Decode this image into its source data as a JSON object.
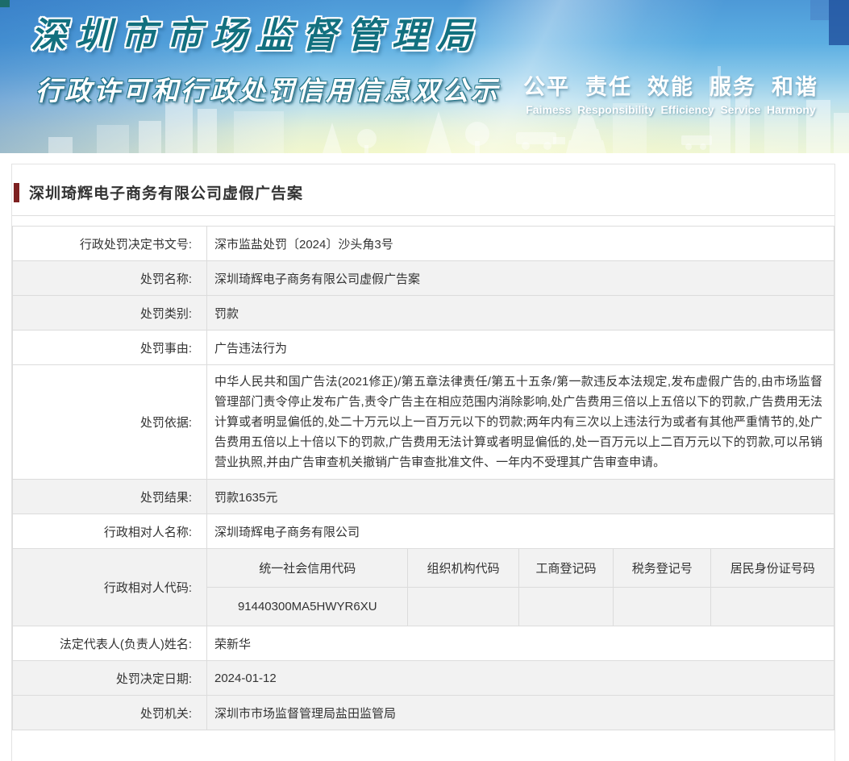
{
  "banner": {
    "title": "深圳市市场监督管理局",
    "subtitle": "行政许可和行政处罚信用信息双公示",
    "slogan_cn": "公平  责任  效能  服务  和谐",
    "slogan_en": "Faimess  Responsibility  Efficiency  Service  Harmony"
  },
  "colors": {
    "accent_bar": "#7d2020",
    "row_stripe": "#f2f2f2",
    "banner_title_teal": "#12707f"
  },
  "page": {
    "title": "深圳琦辉电子商务有限公司虚假广告案"
  },
  "table": {
    "rows": [
      {
        "label": "行政处罚决定书文号:",
        "value": "深市监盐处罚〔2024〕沙头角3号"
      },
      {
        "label": "处罚名称:",
        "value": "深圳琦辉电子商务有限公司虚假广告案"
      },
      {
        "label": "处罚类别:",
        "value": "罚款"
      },
      {
        "label": "处罚事由:",
        "value": "广告违法行为"
      },
      {
        "label": "处罚依据:",
        "value": "中华人民共和国广告法(2021修正)/第五章法律责任/第五十五条/第一款违反本法规定,发布虚假广告的,由市场监督管理部门责令停止发布广告,责令广告主在相应范围内消除影响,处广告费用三倍以上五倍以下的罚款,广告费用无法计算或者明显偏低的,处二十万元以上一百万元以下的罚款;两年内有三次以上违法行为或者有其他严重情节的,处广告费用五倍以上十倍以下的罚款,广告费用无法计算或者明显偏低的,处一百万元以上二百万元以下的罚款,可以吊销营业执照,并由广告审查机关撤销广告审查批准文件、一年内不受理其广告审查申请。"
      },
      {
        "label": "处罚结果:",
        "value": "罚款1635元"
      },
      {
        "label": "行政相对人名称:",
        "value": "深圳琦辉电子商务有限公司"
      },
      {
        "label": "法定代表人(负责人)姓名:",
        "value": "荣新华"
      },
      {
        "label": "处罚决定日期:",
        "value": "2024-01-12"
      },
      {
        "label": "处罚机关:",
        "value": "深圳市市场监督管理局盐田监管局"
      }
    ],
    "code_row": {
      "label": "行政相对人代码:",
      "columns": [
        "统一社会信用代码",
        "组织机构代码",
        "工商登记码",
        "税务登记号",
        "居民身份证号码"
      ],
      "values": [
        "91440300MA5HWYR6XU",
        "",
        "",
        "",
        ""
      ]
    }
  }
}
